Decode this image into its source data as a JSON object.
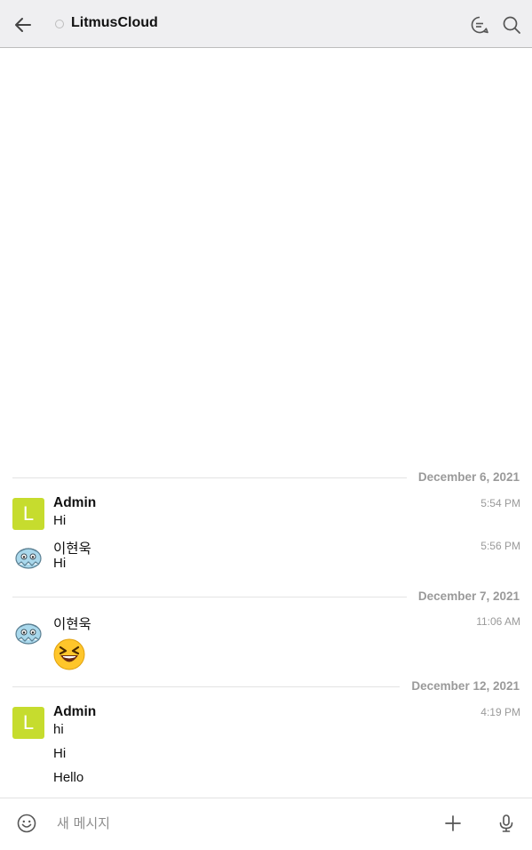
{
  "header": {
    "title": "LitmusCloud",
    "back_icon": "arrow-left-icon",
    "chat_icon": "chat-bubble-icon",
    "search_icon": "search-icon"
  },
  "date_separators": [
    {
      "label": "December 6, 2021"
    },
    {
      "label": "December 7, 2021"
    },
    {
      "label": "December 12, 2021"
    }
  ],
  "messages": [
    {
      "sender": "Admin",
      "avatar_letter": "L",
      "time": "5:54 PM",
      "lines": [
        "Hi"
      ]
    },
    {
      "sender": "이현욱",
      "time": "5:56 PM",
      "lines": [
        "Hi"
      ]
    },
    {
      "sender": "이현욱",
      "time": "11:06 AM",
      "emoji": "laughing-face-emoji"
    },
    {
      "sender": "Admin",
      "avatar_letter": "L",
      "time": "4:19 PM",
      "lines": [
        "hi",
        "Hi",
        "Hello"
      ]
    }
  ],
  "input": {
    "placeholder": "새 메시지",
    "emoji_icon": "smiley-icon",
    "attach_icon": "plus-icon",
    "voice_icon": "microphone-icon"
  },
  "colors": {
    "header_bg": "#efeff1",
    "avatar_admin": "#c6dc2e",
    "muted_text": "#9a9a9a"
  }
}
